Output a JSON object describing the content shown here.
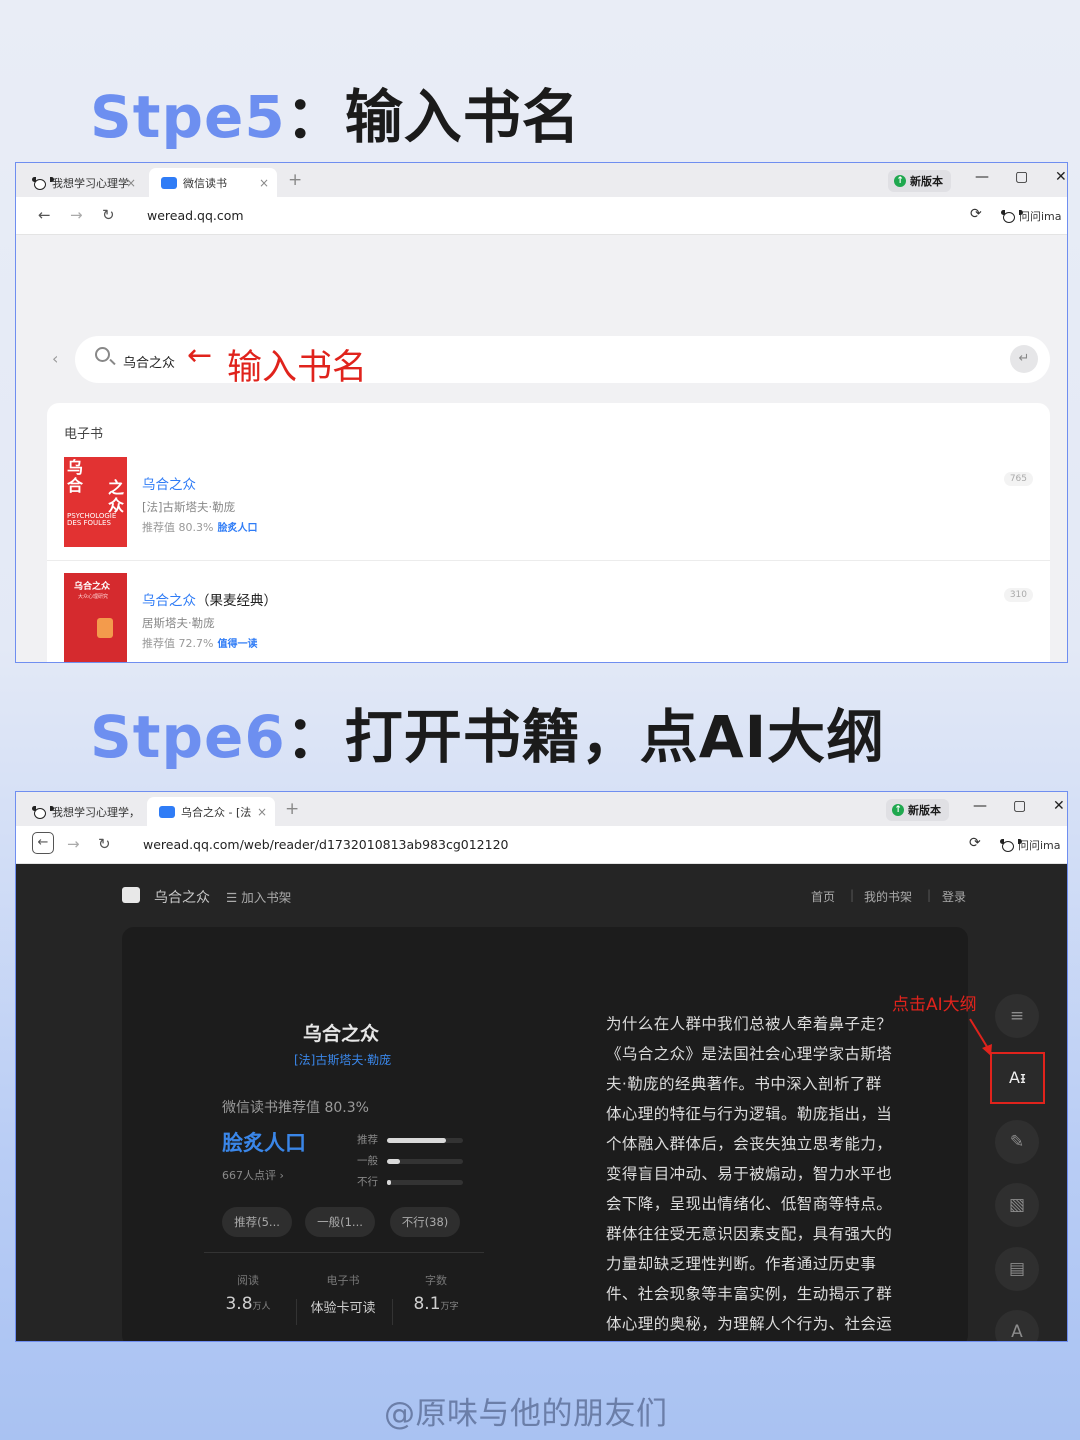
{
  "step5": {
    "prefix": "Stpe5",
    "rest": "：输入书名"
  },
  "step6": {
    "prefix": "Stpe6",
    "rest": "：打开书籍，点AI大纲"
  },
  "shot1": {
    "tabs": [
      {
        "label": "我想学习心理学",
        "close": "×"
      },
      {
        "label": "微信读书",
        "close": "×"
      }
    ],
    "new_tab": "+",
    "new_version": "新版本",
    "win": {
      "min": "—",
      "max": "▢",
      "close": "✕"
    },
    "url": "weread.qq.com",
    "ima": "问问ima",
    "search": {
      "value": "乌合之众",
      "hint": "输入书名"
    },
    "results": {
      "category": "电子书",
      "items": [
        {
          "title": "乌合之众",
          "edition": "",
          "author": "[法]古斯塔夫·勒庞",
          "rec": "推荐值 80.3%",
          "badge": "脍炙人口",
          "count": "765",
          "cover_lines": [
            "乌合",
            "之众"
          ],
          "cover_en": "PSYCHOLOGIE DES FOULES"
        },
        {
          "title": "乌合之众",
          "edition": "（果麦经典）",
          "author": "居斯塔夫·勒庞",
          "rec": "推荐值 72.7%",
          "badge": "值得一读",
          "count": "310",
          "cover_title": "乌合之众",
          "cover_sub": "大众心理研究"
        }
      ]
    }
  },
  "shot2": {
    "tabs": [
      {
        "label": "我想学习心理学，",
        "close": ""
      },
      {
        "label": "乌合之众 - [法",
        "close": "×"
      }
    ],
    "new_tab": "+",
    "new_version": "新版本",
    "win": {
      "min": "—",
      "max": "▢",
      "close": "✕"
    },
    "url": "weread.qq.com/web/reader/d1732010813ab983cg012120",
    "ima": "问问ima",
    "reader": {
      "book_title": "乌合之众",
      "shelf": "加入书架",
      "nav": [
        "首页",
        "我的书架",
        "登录"
      ],
      "title": "乌合之众",
      "author": "[法]古斯塔夫·勒庞",
      "rec_line": "微信读书推荐值 80.3%",
      "badge": "脍炙人口",
      "ratings": "667人点评 ›",
      "bars": [
        {
          "label": "推荐",
          "value": 0.78
        },
        {
          "label": "一般",
          "value": 0.17
        },
        {
          "label": "不行",
          "value": 0.05
        }
      ],
      "pills": [
        "推荐(5...",
        "一般(1...",
        "不行(38)"
      ],
      "stats": [
        {
          "label": "阅读",
          "value": "3.8",
          "unit": "万人"
        },
        {
          "label": "电子书",
          "value": "体验卡可读",
          "unit": ""
        },
        {
          "label": "字数",
          "value": "8.1",
          "unit": "万字"
        }
      ],
      "intro": "为什么在人群中我们总被人牵着鼻子走？《乌合之众》是法国社会心理学家古斯塔夫·勒庞的经典著作。书中深入剖析了群体心理的特征与行为逻辑。勒庞指出，当个体融入群体后，会丧失独立思考能力，变得盲目冲动、易于被煽动，智力水平也会下降，呈现出情绪化、低智商等特点。群体往往受无意识因素支配，具有强大的力量却缺乏理性判断。作者通过历史事件、社会现象等丰富实例，生动揭示了群体心理的奥秘，为理解人个行为、社会运动以及例",
      "side_buttons": [
        "menu-icon",
        "ai-icon",
        "pen-icon",
        "no-image-icon",
        "notes-icon",
        "font-icon"
      ],
      "ai_label": "Aᵻ",
      "font_label": "A",
      "annotation": "点击AI大纲"
    }
  },
  "watermark": "@原味与他的朋友们",
  "colors": {
    "accent": "#6d8ff0",
    "red": "#e0231c",
    "link": "#2f7cf6"
  }
}
